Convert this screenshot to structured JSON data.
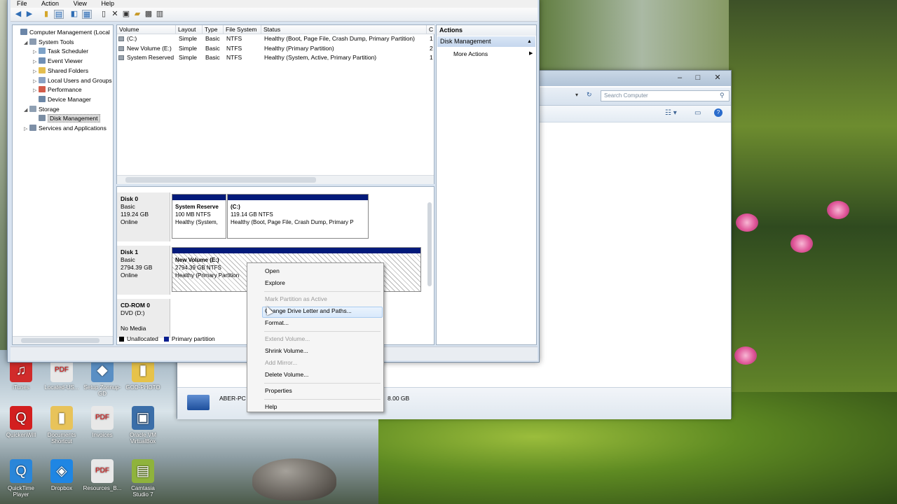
{
  "desktop": {
    "icons": [
      {
        "label": "iTunes",
        "icon": "itunes-icon",
        "color": "#d12b2b",
        "glyph": "♫"
      },
      {
        "label": "Located-US...",
        "icon": "pdf-icon",
        "color": "#e8e8e8",
        "glyph": "PDF"
      },
      {
        "label": "Setup Zonnup-GD",
        "icon": "setup-icon",
        "color": "#5a8fc4",
        "glyph": "◆"
      },
      {
        "label": "GOD-PHOTO",
        "icon": "folder-icon",
        "color": "#e6c24a",
        "glyph": "▮"
      },
      {
        "label": "QuickenWill",
        "icon": "quicken-icon",
        "color": "#d31f1f",
        "glyph": "Q"
      },
      {
        "label": "Documents Shortcut",
        "icon": "folder-icon",
        "color": "#e8c35a",
        "glyph": "▮"
      },
      {
        "label": "Invoices",
        "icon": "pdf-icon",
        "color": "#e8e8e8",
        "glyph": "PDF"
      },
      {
        "label": "Oracle VM VirtualBox",
        "icon": "virtualbox-icon",
        "color": "#3b6ea8",
        "glyph": "▣"
      },
      {
        "label": "QuickTime Player",
        "icon": "quicktime-icon",
        "color": "#2a86d9",
        "glyph": "Q"
      },
      {
        "label": "Dropbox",
        "icon": "dropbox-icon",
        "color": "#1f86e3",
        "glyph": "◈"
      },
      {
        "label": "Resources_B...",
        "icon": "pdf-icon",
        "color": "#e8e8e8",
        "glyph": "PDF"
      },
      {
        "label": "Camtasia Studio 7",
        "icon": "camtasia-icon",
        "color": "#8fb33c",
        "glyph": "▤"
      }
    ]
  },
  "back_window": {
    "search_placeholder": "Search Computer",
    "computer_name": "ABER-PC",
    "status_size": "8.00 GB"
  },
  "mmc": {
    "menu": [
      "File",
      "Action",
      "View",
      "Help"
    ],
    "tree": [
      {
        "label": "Computer Management (Local",
        "indent": 0,
        "exp": "",
        "icon": "computer-management-icon",
        "color": "#6b86a8"
      },
      {
        "label": "System Tools",
        "indent": 1,
        "exp": "◢",
        "icon": "system-tools-icon",
        "color": "#8a9bb0"
      },
      {
        "label": "Task Scheduler",
        "indent": 2,
        "exp": "▷",
        "icon": "task-scheduler-icon",
        "color": "#7ea3c8"
      },
      {
        "label": "Event Viewer",
        "indent": 2,
        "exp": "▷",
        "icon": "event-viewer-icon",
        "color": "#6f8fb5"
      },
      {
        "label": "Shared Folders",
        "indent": 2,
        "exp": "▷",
        "icon": "shared-folders-icon",
        "color": "#e4be4f"
      },
      {
        "label": "Local Users and Groups",
        "indent": 2,
        "exp": "▷",
        "icon": "users-icon",
        "color": "#8aa2c4"
      },
      {
        "label": "Performance",
        "indent": 2,
        "exp": "▷",
        "icon": "performance-icon",
        "color": "#d35c4a"
      },
      {
        "label": "Device Manager",
        "indent": 2,
        "exp": "",
        "icon": "device-manager-icon",
        "color": "#6c87a6"
      },
      {
        "label": "Storage",
        "indent": 1,
        "exp": "◢",
        "icon": "storage-icon",
        "color": "#8fa0b3"
      },
      {
        "label": "Disk Management",
        "indent": 2,
        "exp": "",
        "icon": "disk-management-icon",
        "color": "#7a8da3",
        "selected": true
      },
      {
        "label": "Services and Applications",
        "indent": 1,
        "exp": "▷",
        "icon": "services-icon",
        "color": "#7d8fa6"
      }
    ],
    "columns": [
      "Volume",
      "Layout",
      "Type",
      "File System",
      "Status",
      "C"
    ],
    "volumes": [
      {
        "volume": "(C:)",
        "layout": "Simple",
        "type": "Basic",
        "fs": "NTFS",
        "status": "Healthy (Boot, Page File, Crash Dump, Primary Partition)",
        "c": "1"
      },
      {
        "volume": "New Volume (E:)",
        "layout": "Simple",
        "type": "Basic",
        "fs": "NTFS",
        "status": "Healthy (Primary Partition)",
        "c": "2"
      },
      {
        "volume": "System Reserved",
        "layout": "Simple",
        "type": "Basic",
        "fs": "NTFS",
        "status": "Healthy (System, Active, Primary Partition)",
        "c": "1"
      }
    ],
    "actions": {
      "title": "Actions",
      "section": "Disk Management",
      "more": "More Actions"
    },
    "disks": [
      {
        "name": "Disk 0",
        "type": "Basic",
        "size": "119.24 GB",
        "state": "Online",
        "parts": [
          {
            "name": "System Reserve",
            "size": "100 MB NTFS",
            "status": "Healthy (System,"
          },
          {
            "name": "(C:)",
            "size": "119.14 GB NTFS",
            "status": "Healthy (Boot, Page File, Crash Dump, Primary P"
          }
        ]
      },
      {
        "name": "Disk 1",
        "type": "Basic",
        "size": "2794.39 GB",
        "state": "Online",
        "parts": [
          {
            "name": "New Volume (E:)",
            "size": "2794.39 GB NTFS",
            "status": "Healthy (Primary Partition"
          }
        ]
      },
      {
        "name": "CD-ROM 0",
        "type": "DVD (D:)",
        "size": "",
        "state": "No Media",
        "parts": []
      }
    ],
    "legend": [
      {
        "label": "Unallocated",
        "color": "#000000"
      },
      {
        "label": "Primary partition",
        "color": "#0a1f8f"
      }
    ]
  },
  "context_menu": {
    "items": [
      {
        "label": "Open",
        "disabled": false
      },
      {
        "label": "Explore",
        "disabled": false
      },
      {
        "sep": true
      },
      {
        "label": "Mark Partition as Active",
        "disabled": true
      },
      {
        "label": "Change Drive Letter and Paths...",
        "disabled": false,
        "highlight": true
      },
      {
        "label": "Format...",
        "disabled": false
      },
      {
        "sep": true
      },
      {
        "label": "Extend Volume...",
        "disabled": true
      },
      {
        "label": "Shrink Volume...",
        "disabled": false
      },
      {
        "label": "Add Mirror...",
        "disabled": true
      },
      {
        "label": "Delete Volume...",
        "disabled": false
      },
      {
        "sep": true
      },
      {
        "label": "Properties",
        "disabled": false
      },
      {
        "sep": true
      },
      {
        "label": "Help",
        "disabled": false
      }
    ]
  }
}
